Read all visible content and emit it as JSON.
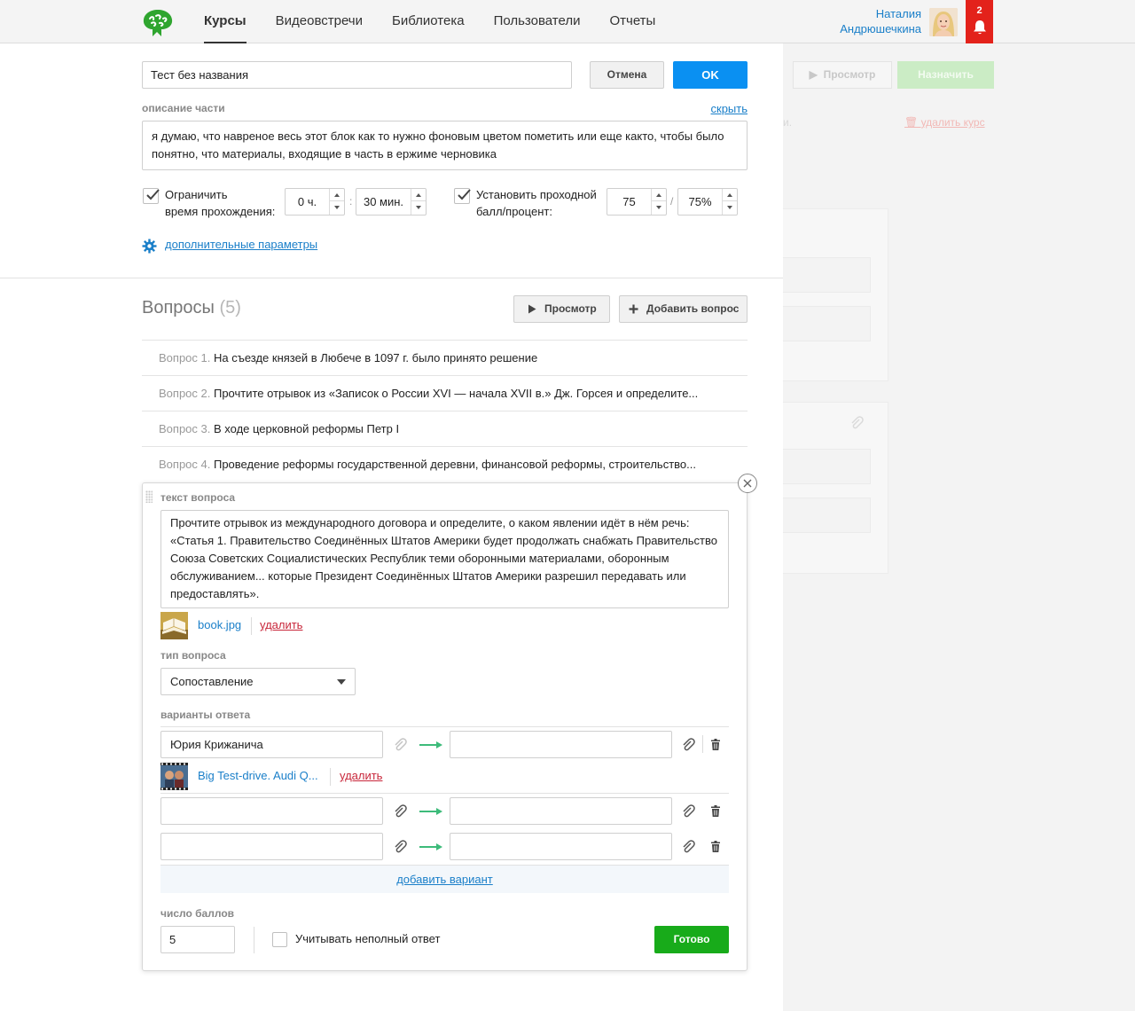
{
  "nav": {
    "items": [
      {
        "label": "Курсы",
        "active": true
      },
      {
        "label": "Видеовстречи",
        "active": false
      },
      {
        "label": "Библиотека",
        "active": false
      },
      {
        "label": "Пользователи",
        "active": false
      },
      {
        "label": "Отчеты",
        "active": false
      }
    ]
  },
  "user": {
    "first_name": "Наталия",
    "last_name": "Андрюшечкина",
    "avatar_icon": "user-photo"
  },
  "notifications": {
    "count": "2",
    "icon": "bell-icon",
    "color": "#e3221b"
  },
  "editor": {
    "title_value": "Тест без названия",
    "cancel_label": "Отмена",
    "ok_label": "OK",
    "desc_label": "описание части",
    "hide_link": "скрыть",
    "description": "я думаю, что навреное весь этот блок как то нужно фоновым цветом пометить или еще както, чтобы было понятно, что  материалы, входящие в часть в ержиме черновика",
    "time_limit": {
      "checked": true,
      "label_line1": "Ограничить",
      "label_line2": "время прохождения:",
      "hours": "0 ч.",
      "minutes": "30 мин.",
      "separator": ":"
    },
    "pass_score": {
      "checked": true,
      "label_line1": "Установить проходной",
      "label_line2": "балл/процент:",
      "score": "75",
      "percent": "75%",
      "separator": "/"
    },
    "advanced_link": "дополнительные параметры",
    "advanced_icon": "gear-icon"
  },
  "questions": {
    "title": "Вопросы",
    "count": "(5)",
    "preview_label": "Просмотр",
    "add_label": "Добавить вопрос",
    "items": [
      {
        "num": "Вопрос 1.",
        "text": "На съезде князей в Любече в 1097 г. было принято решение"
      },
      {
        "num": "Вопрос 2.",
        "text": "Прочтите отрывок из «Записок о России XVI — начала XVII в.» Дж. Горсея и определите..."
      },
      {
        "num": "Вопрос 3.",
        "text": "В ходе церковной реформы Петр I"
      },
      {
        "num": "Вопрос 4.",
        "text": "Проведение реформы государственной деревни, финансовой реформы, строительство..."
      }
    ]
  },
  "question_editor": {
    "text_label": "текст вопроса",
    "text": "Прочтите отрывок из международного договора и определите, о каком явлении идёт в нём речь: «Статья 1. Правительство Соединённых Штатов Америки будет продолжать снабжать Правительство Союза Советских Социалистических Республик теми оборонными материалами, оборонным обслуживанием... которые Президент Соединённых Штатов Америки разрешил передавать или предоставлять».",
    "attachment": {
      "name": "book.jpg",
      "delete_label": "удалить"
    },
    "type_label": "тип вопроса",
    "type_value": "Сопоставление",
    "answers_label": "варианты ответа",
    "answers": [
      {
        "left": "Юрия Крижанича",
        "right": "",
        "attachment": {
          "name": "Big Test-drive. Audi Q...",
          "delete_label": "удалить"
        }
      },
      {
        "left": "",
        "right": ""
      },
      {
        "left": "",
        "right": ""
      }
    ],
    "add_variant": "добавить вариант",
    "score_label": "число баллов",
    "score_value": "5",
    "partial_label": "Учитывать неполный ответ",
    "partial_checked": false,
    "done_label": "Готово",
    "done_color": "#18ab1a"
  },
  "background_pane": {
    "preview_label": "Просмотр",
    "assign_label": "Назначить",
    "delete_course": "удалить курс"
  }
}
